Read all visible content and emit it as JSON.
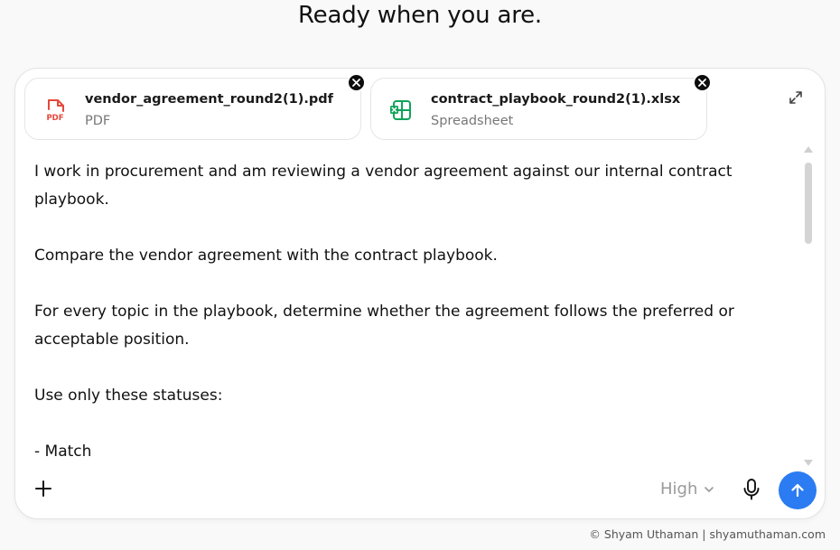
{
  "headline": "Ready when you are.",
  "attachments": [
    {
      "name": "vendor_agreement_round2(1).pdf",
      "type": "PDF",
      "icon": "pdf-file-icon",
      "color": "#e5483a"
    },
    {
      "name": "contract_playbook_round2(1).xlsx",
      "type": "Spreadsheet",
      "icon": "spreadsheet-file-icon",
      "color": "#10a35a"
    }
  ],
  "message": "I work in procurement and am reviewing a vendor agreement against our internal contract playbook.\n\nCompare the vendor agreement with the contract playbook.\n\nFor every topic in the playbook, determine whether the agreement follows the preferred or acceptable position.\n\nUse only these statuses:\n\n- Match\n- Deviation",
  "toolbar": {
    "effort_label": "High",
    "icons": {
      "add": "plus-icon",
      "effort": "chevron-down-icon",
      "mic": "microphone-icon",
      "send": "arrow-up-icon",
      "expand": "expand-icon",
      "remove": "close-icon"
    },
    "send_color": "#2b7bf2"
  },
  "footer": "© Shyam Uthaman | shyamuthaman.com"
}
